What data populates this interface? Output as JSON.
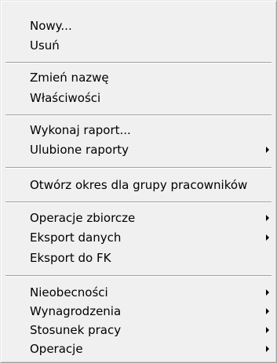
{
  "context_menu": {
    "items": [
      {
        "label": "Nowy..."
      },
      {
        "label": "Usuń"
      },
      {
        "label": "Zmień nazwę"
      },
      {
        "label": "Właściwości"
      },
      {
        "label": "Wykonaj raport..."
      },
      {
        "label": "Ulubione raporty",
        "submenu": true
      },
      {
        "label": "Otwórz okres dla grupy pracowników"
      },
      {
        "label": "Operacje zbiorcze",
        "submenu": true
      },
      {
        "label": "Eksport danych",
        "submenu": true
      },
      {
        "label": "Eksport do FK"
      },
      {
        "label": "Nieobecności",
        "submenu": true
      },
      {
        "label": "Wynagrodzenia",
        "submenu": true
      },
      {
        "label": "Stosunek pracy",
        "submenu": true
      },
      {
        "label": "Operacje",
        "submenu": true
      }
    ]
  }
}
